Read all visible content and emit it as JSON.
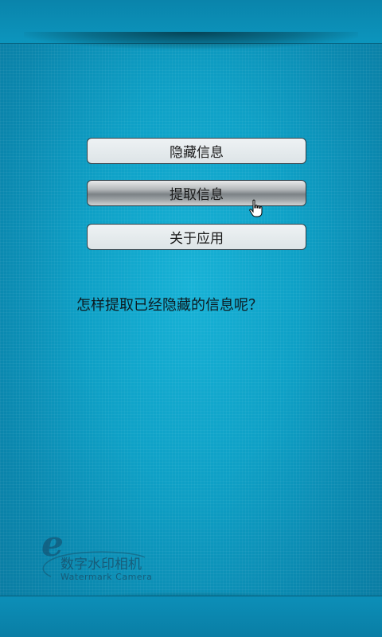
{
  "buttons": {
    "hide_label": "隐藏信息",
    "extract_label": "提取信息",
    "about_label": "关于应用"
  },
  "content": {
    "question": "怎样提取已经隐藏的信息呢？"
  },
  "logo": {
    "letter": "e",
    "title": "数字水印相机",
    "subtitle": "Watermark Camera"
  },
  "colors": {
    "background": "#0ea0c6",
    "button_face": "#e3e9ec",
    "button_border": "#2b3c45"
  },
  "icons": {
    "cursor": "hand-pointer-icon"
  }
}
